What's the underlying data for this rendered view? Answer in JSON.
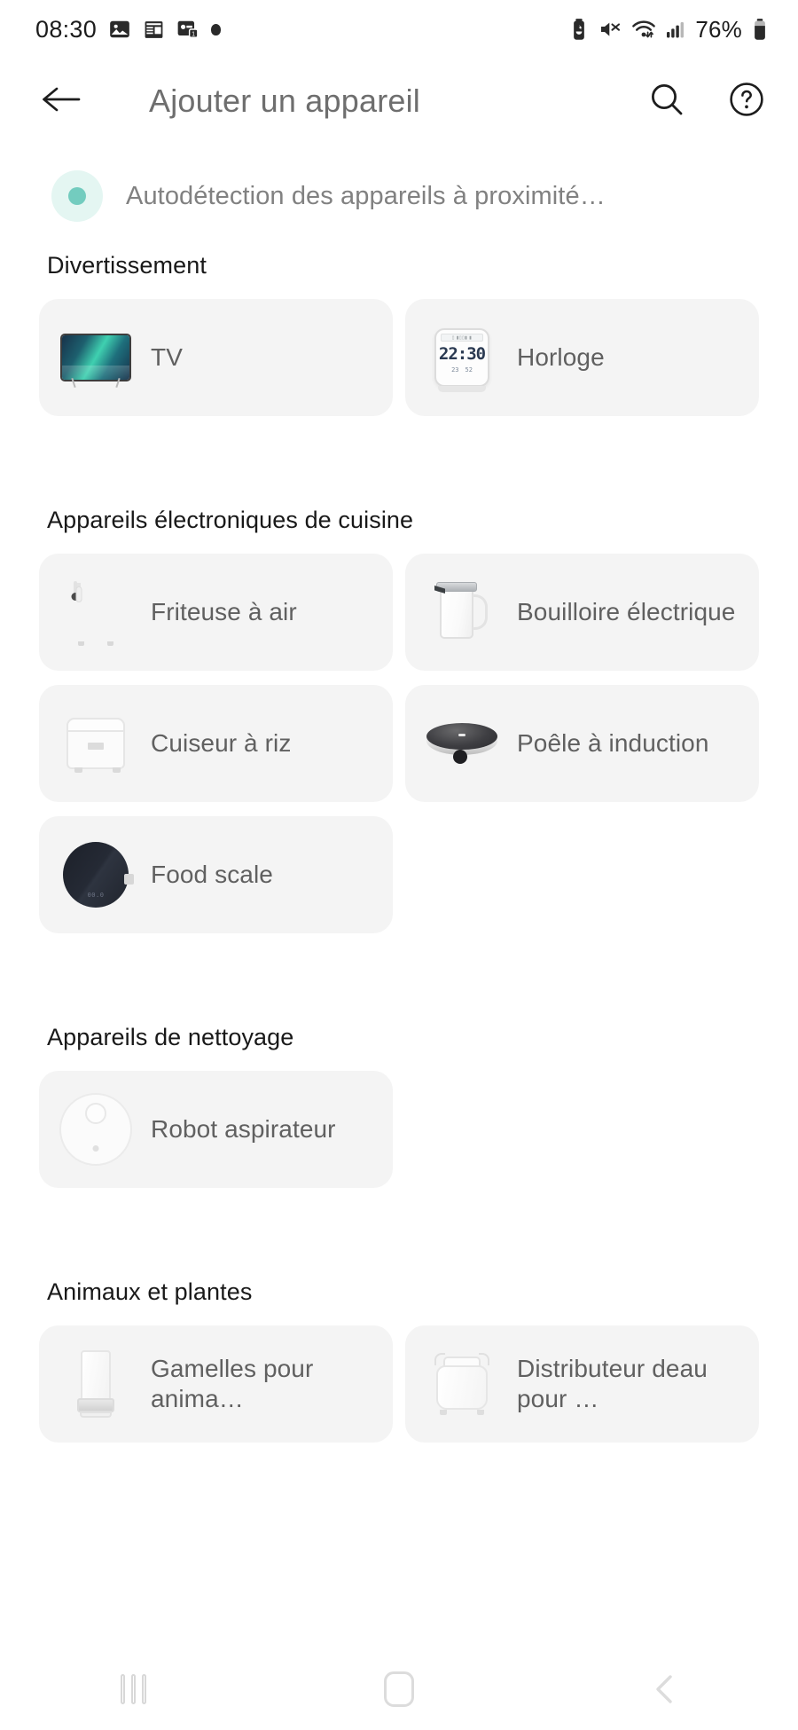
{
  "status_bar": {
    "time": "08:30",
    "battery_percent": "76%",
    "left_icons": [
      "photo-icon",
      "calendar-icon",
      "qr-code-icon",
      "more-dot-icon"
    ],
    "right_icons": [
      "battery-saver-icon",
      "mute-icon",
      "wifi-icon",
      "signal-icon",
      "battery-icon"
    ]
  },
  "app_bar": {
    "back_icon": "back-arrow-icon",
    "title": "Ajouter un appareil",
    "search_icon": "search-icon",
    "help_icon": "help-circle-icon"
  },
  "autodetect": {
    "text": "Autodétection des appareils à proximité…",
    "indicator_color": "#73ccbf",
    "indicator_halo_color": "#e4f6f2"
  },
  "sections": [
    {
      "title": "Divertissement",
      "cards": [
        {
          "label": "TV",
          "icon": "tv-icon"
        },
        {
          "label": "Horloge",
          "icon": "clock-icon",
          "display_time": "22:30",
          "display_temp": "23",
          "display_humidity": "52"
        }
      ]
    },
    {
      "title": "Appareils électroniques de cuisine",
      "cards": [
        {
          "label": "Friteuse à air",
          "icon": "air-fryer-icon"
        },
        {
          "label": "Bouilloire électrique",
          "icon": "electric-kettle-icon"
        },
        {
          "label": "Cuiseur à riz",
          "icon": "rice-cooker-icon"
        },
        {
          "label": "Poêle à induction",
          "icon": "induction-cooker-icon"
        },
        {
          "label": "Food scale",
          "icon": "food-scale-icon"
        }
      ]
    },
    {
      "title": "Appareils de nettoyage",
      "cards": [
        {
          "label": "Robot aspirateur",
          "icon": "robot-vacuum-icon"
        }
      ]
    },
    {
      "title": "Animaux et plantes",
      "cards": [
        {
          "label": "Gamelles pour anima…",
          "icon": "pet-feeder-icon"
        },
        {
          "label": "Distributeur deau pour …",
          "icon": "pet-water-dispenser-icon"
        }
      ]
    }
  ],
  "nav_bar": {
    "recent_icon": "recent-apps-icon",
    "home_icon": "home-icon",
    "back_icon": "nav-back-icon"
  },
  "colors": {
    "card_background": "#f4f4f4",
    "page_background": "#ffffff",
    "label_text": "#606060",
    "section_title_text": "#191919"
  }
}
